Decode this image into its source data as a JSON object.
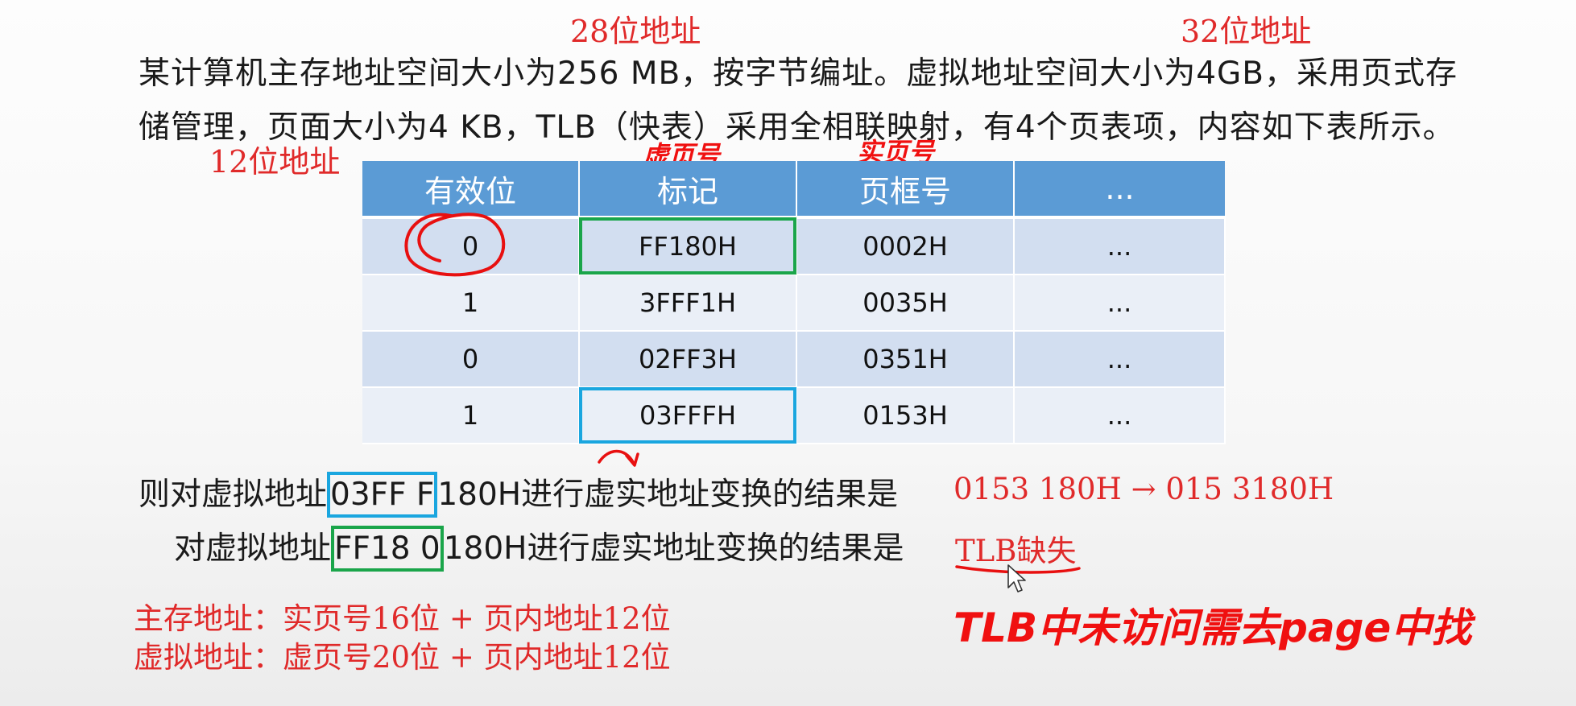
{
  "annotations": {
    "addr28": "28位地址",
    "addr32": "32位地址",
    "addr12": "12位地址",
    "virtual_page_hand": "虚页号",
    "real_page_hand": "实页号",
    "tlb_note_hand": "TLB中未访问需去page中找"
  },
  "paragraph": {
    "line1": "某计算机主存地址空间大小为256 MB，按字节编址。虚拟地址空间大小为4GB，采用页式存",
    "line2": "储管理，页面大小为4 KB，TLB（快表）采用全相联映射，有4个页表项，内容如下表所示。"
  },
  "table": {
    "headers": [
      "有效位",
      "标记",
      "页框号",
      "..."
    ],
    "rows": [
      [
        "0",
        "FF180H",
        "0002H",
        "..."
      ],
      [
        "1",
        "3FFF1H",
        "0035H",
        "..."
      ],
      [
        "0",
        "02FF3H",
        "0351H",
        "..."
      ],
      [
        "1",
        "03FFFH",
        "0153H",
        "..."
      ]
    ]
  },
  "questions": {
    "q1_prefix": "则对虚拟地址",
    "q1_boxed": "03FF F",
    "q1_suffix": "180H进行虚实地址变换的结果是",
    "q1_answer": "0153 180H → 015 3180H",
    "q2_prefix": "对虚拟地址",
    "q2_boxed": "FF18 0",
    "q2_suffix": "180H进行虚实地址变换的结果是",
    "q2_answer": "TLB缺失"
  },
  "notes": {
    "main_memory": "主存地址：实页号16位 + 页内地址12位",
    "virtual": "虚拟地址：虚页号20位 + 页内地址12位"
  },
  "colors": {
    "annotation_red": "#e02a2a",
    "header_blue": "#5b9bd5",
    "row_dark": "#d2def0",
    "row_light": "#eaeff7",
    "box_green": "#1aa54a",
    "box_blue": "#1aa6df"
  }
}
